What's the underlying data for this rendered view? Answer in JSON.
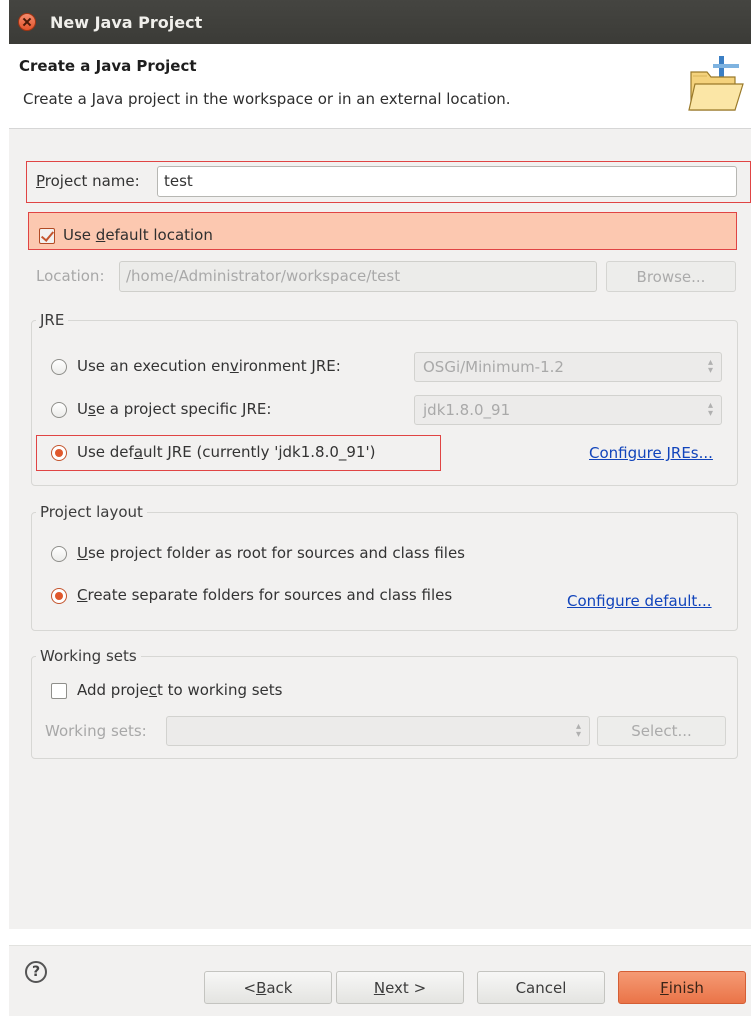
{
  "window": {
    "title": "New Java Project"
  },
  "banner": {
    "title": "Create a Java Project",
    "description": "Create a Java project in the workspace or in an external location.",
    "icon": "folder-wizard-icon"
  },
  "project": {
    "name_label_first": "P",
    "name_label_rest": "roject name:",
    "name_value": "test",
    "use_default_pre": "Use ",
    "use_default_u": "d",
    "use_default_post": "efault location",
    "use_default_checked": true,
    "location_label": "Location:",
    "location_value": "/home/Administrator/workspace/test",
    "browse_label": "Browse..."
  },
  "jre": {
    "group_title": "JRE",
    "option_exec_pre": "Use an execution en",
    "option_exec_u": "v",
    "option_exec_post": "ironment JRE:",
    "exec_env_value": "OSGi/Minimum-1.2",
    "option_specific_pre": "U",
    "option_specific_u": "s",
    "option_specific_post": "e a project specific JRE:",
    "specific_value": "jdk1.8.0_91",
    "option_default_pre": "Use def",
    "option_default_u": "a",
    "option_default_post": "ult JRE (currently 'jdk1.8.0_91')",
    "selected": "default",
    "configure_link": "Configure JREs..."
  },
  "layout": {
    "group_title": "Project layout",
    "option_root_u": "U",
    "option_root_post": "se project folder as root for sources and class files",
    "option_separate_u": "C",
    "option_separate_post": "reate separate folders for sources and class files",
    "selected": "separate",
    "configure_link": "Configure default..."
  },
  "working_sets": {
    "group_title": "Working sets",
    "add_pre": "Add proje",
    "add_u": "c",
    "add_post": "t to working sets",
    "add_checked": false,
    "label": "Working sets:",
    "select_label": "Select..."
  },
  "footer": {
    "help": "?",
    "back_pre": "< ",
    "back_u": "B",
    "back_post": "ack",
    "next_u": "N",
    "next_post": "ext >",
    "cancel": "Cancel",
    "finish_u": "F",
    "finish_post": "inish"
  },
  "colors": {
    "accent": "#ea7448",
    "highlight_border": "#e04444",
    "highlight_fill": "#fcc8b0",
    "link": "#1144bb"
  }
}
